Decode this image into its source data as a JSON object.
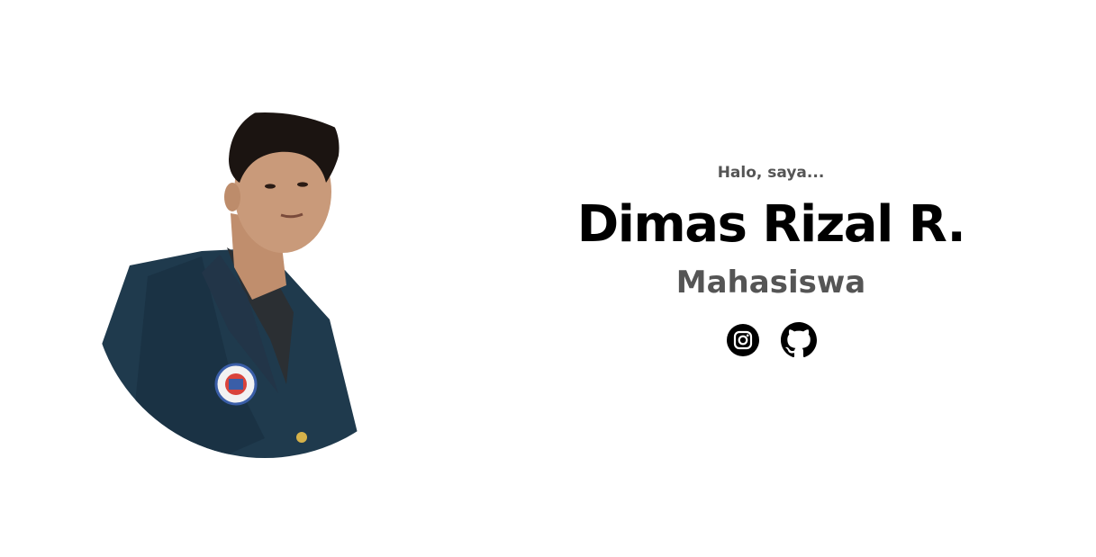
{
  "profile": {
    "greeting": "Halo, saya...",
    "name": "Dimas Rizal R.",
    "role": "Mahasiswa"
  },
  "socials": [
    {
      "icon": "instagram-icon"
    },
    {
      "icon": "github-icon"
    }
  ],
  "colors": {
    "background": "#ffffff",
    "name": "#000000",
    "muted_text": "#555555",
    "icon": "#000000",
    "jacket": "#1f3a4d",
    "skin": "#c99a7a",
    "hair": "#1b1411"
  }
}
